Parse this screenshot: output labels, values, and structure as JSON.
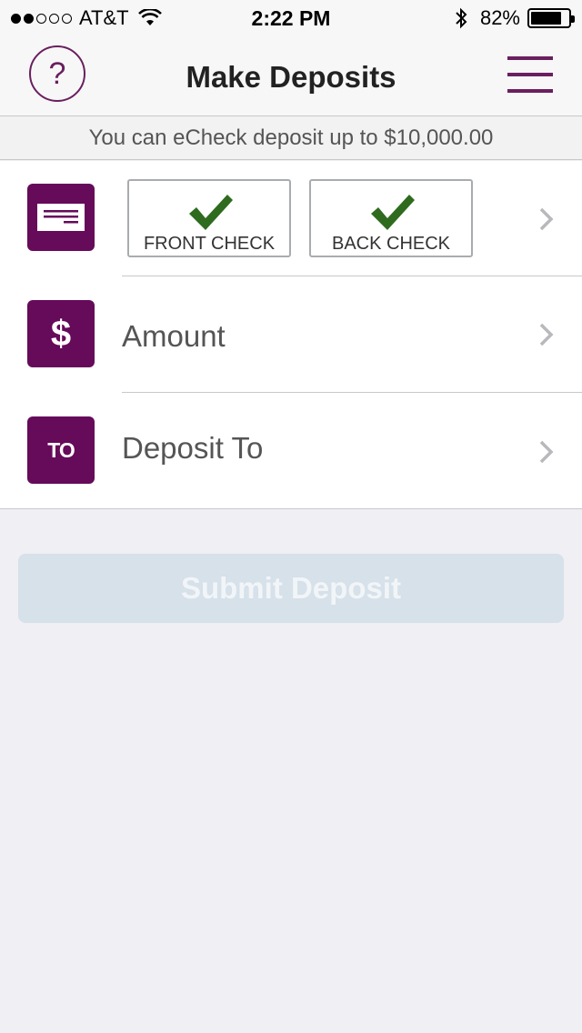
{
  "status_bar": {
    "carrier": "AT&T",
    "time": "2:22 PM",
    "battery_percent": "82%",
    "battery_level": 0.82,
    "signal_bars_filled": 2,
    "signal_bars_total": 5
  },
  "nav": {
    "help_label": "?",
    "title": "Make Deposits",
    "menu_icon": "hamburger-menu-icon"
  },
  "notice": {
    "text": "You can eCheck deposit up to $10,000.00"
  },
  "rows": {
    "check": {
      "icon": "check-icon",
      "front_label": "FRONT CHECK",
      "back_label": "BACK CHECK",
      "front_captured": true,
      "back_captured": true
    },
    "amount": {
      "icon_text": "$",
      "label": "Amount"
    },
    "deposit_to": {
      "icon_text": "TO",
      "label": "Deposit To"
    }
  },
  "submit": {
    "label": "Submit Deposit",
    "enabled": false
  },
  "colors": {
    "brand_purple": "#660a5a",
    "checkmark_green": "#2e6b1f",
    "submit_disabled_bg": "#d6e1ea",
    "background": "#efeff4"
  }
}
